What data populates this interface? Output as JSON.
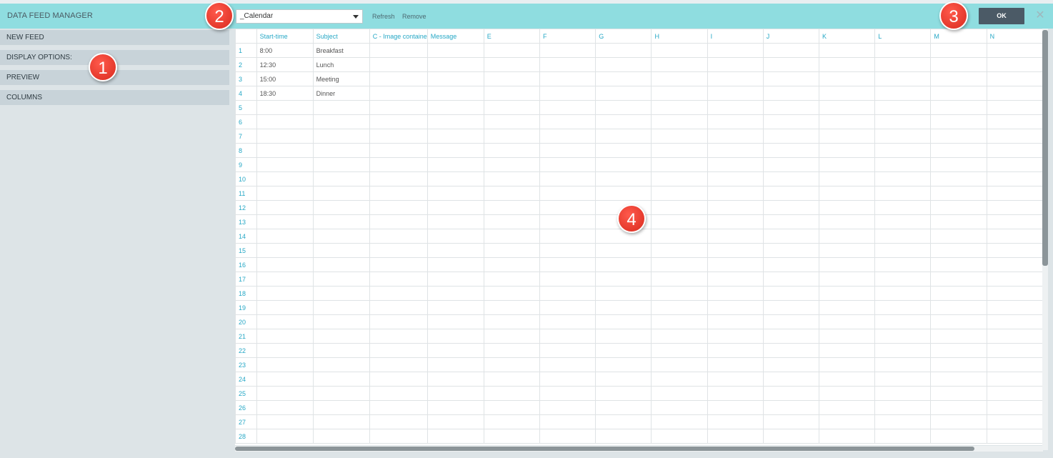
{
  "header": {
    "title": "DATA FEED MANAGER",
    "feed_selected": "_Calendar",
    "refresh_label": "Refresh",
    "remove_label": "Remove",
    "ok_label": "OK",
    "close_glyph": "✕"
  },
  "sidebar": {
    "items": [
      {
        "label": "NEW FEED"
      },
      {
        "label": "DISPLAY OPTIONS:"
      },
      {
        "label": "PREVIEW"
      },
      {
        "label": "COLUMNS"
      }
    ]
  },
  "grid": {
    "columns": [
      "Start-time",
      "Subject",
      "C - Image containe",
      "Message",
      "E",
      "F",
      "G",
      "H",
      "I",
      "J",
      "K",
      "L",
      "M",
      "N"
    ],
    "rows": [
      [
        "8:00",
        "Breakfast"
      ],
      [
        "12:30",
        "Lunch"
      ],
      [
        "15:00",
        "Meeting"
      ],
      [
        "18:30",
        "Dinner"
      ]
    ],
    "row_count": 28
  },
  "callouts": [
    "1",
    "2",
    "3",
    "4"
  ],
  "colors": {
    "header_bg": "#8fdde0",
    "accent_text": "#27a8c6",
    "ok_button": "#4b5a66",
    "callout": "#e0352a"
  }
}
